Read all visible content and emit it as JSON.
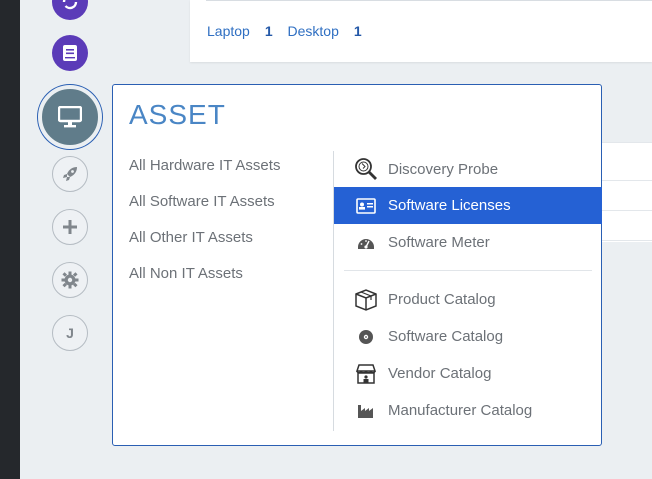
{
  "top_card": {
    "stats": [
      {
        "label": "Laptop",
        "count": "1"
      },
      {
        "label": "Desktop",
        "count": "1"
      }
    ]
  },
  "sidebar": {
    "icons": [
      "refresh-icon",
      "book-icon",
      "monitor-icon",
      "rocket-icon",
      "plus-icon",
      "gear-icon",
      "user-initial-icon"
    ],
    "user_initial": "J"
  },
  "flyout": {
    "title": "ASSET",
    "left_links": [
      "All Hardware IT Assets",
      "All Software IT Assets",
      "All Other IT Assets",
      "All Non IT Assets"
    ],
    "right_group1": [
      {
        "label": "Discovery Probe",
        "icon": "probe-icon"
      },
      {
        "label": "Software Licenses",
        "icon": "id-card-icon",
        "selected": true
      },
      {
        "label": "Software Meter",
        "icon": "gauge-icon"
      }
    ],
    "right_group2": [
      {
        "label": "Product Catalog",
        "icon": "box-icon"
      },
      {
        "label": "Software Catalog",
        "icon": "disc-icon"
      },
      {
        "label": "Vendor Catalog",
        "icon": "store-icon"
      },
      {
        "label": "Manufacturer Catalog",
        "icon": "factory-icon"
      }
    ]
  },
  "colors": {
    "accent": "#2561d4",
    "title": "#4a86c5",
    "sidebar_purple": "#5b3bb8",
    "active_icon_bg": "#607c8a"
  }
}
